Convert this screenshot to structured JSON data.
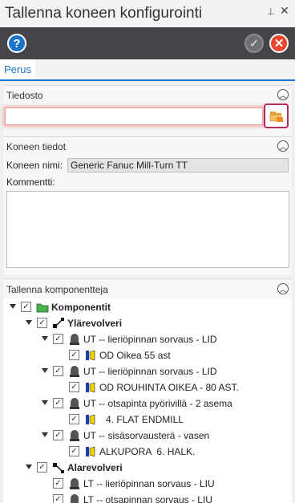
{
  "window": {
    "title": "Tallenna koneen konfigurointi",
    "pin_icon": "pin-icon",
    "close_icon": "close-icon"
  },
  "toolbar": {
    "help_label": "?",
    "ok_label": "✓",
    "cancel_label": "✕"
  },
  "tabs": [
    {
      "label": "Perus"
    }
  ],
  "file_section": {
    "title": "Tiedosto",
    "value": ""
  },
  "machine_section": {
    "title": "Koneen tiedot",
    "name_label": "Koneen nimi:",
    "name_value": "Generic Fanuc Mill-Turn TT",
    "comment_label": "Kommentti:",
    "comment_value": ""
  },
  "components_section": {
    "title": "Tallenna komponentteja",
    "tree": [
      {
        "text": "Komponentit",
        "bold": true,
        "icon": "folder-icon",
        "checked": true,
        "expand": true
      },
      {
        "text": "Ylärevolveri",
        "bold": true,
        "icon": "turret-upper-icon",
        "checked": true,
        "expand": true
      },
      {
        "text": "UT -- lieriöpinnan sorvaus - LID",
        "icon": "holder-icon",
        "checked": true,
        "expand": true
      },
      {
        "text": "OD Oikea 55 ast",
        "icon": "insert-icon",
        "checked": true,
        "expand": false
      },
      {
        "text": "UT -- lieriöpinnan sorvaus - LID",
        "icon": "holder-icon",
        "checked": true,
        "expand": true
      },
      {
        "text": "OD ROUHINTA OIKEA - 80 AST.",
        "icon": "insert-icon",
        "checked": true,
        "expand": false
      },
      {
        "text": "UT -- otsapinta pyörivillä - 2 asema",
        "icon": "holder-icon",
        "checked": true,
        "expand": true
      },
      {
        "text": "4. FLAT ENDMILL",
        "icon": "insert-icon",
        "checked": true,
        "expand": false
      },
      {
        "text": "UT -- sisäsorvausterä - vasen",
        "icon": "holder-icon",
        "checked": true,
        "expand": true
      },
      {
        "text": "ALKUPORA  6. HALK.",
        "icon": "insert-icon",
        "checked": true,
        "expand": false
      },
      {
        "text": "Alarevolveri",
        "bold": true,
        "icon": "turret-lower-icon",
        "checked": true,
        "expand": true
      },
      {
        "text": "LT -- lieriöpinnan sorvaus - LIU",
        "icon": "holder-icon",
        "checked": true,
        "expand": false
      },
      {
        "text": "LT -- otsapinnan sorvaus - LIU",
        "icon": "holder-icon",
        "checked": true,
        "expand": false
      }
    ]
  }
}
